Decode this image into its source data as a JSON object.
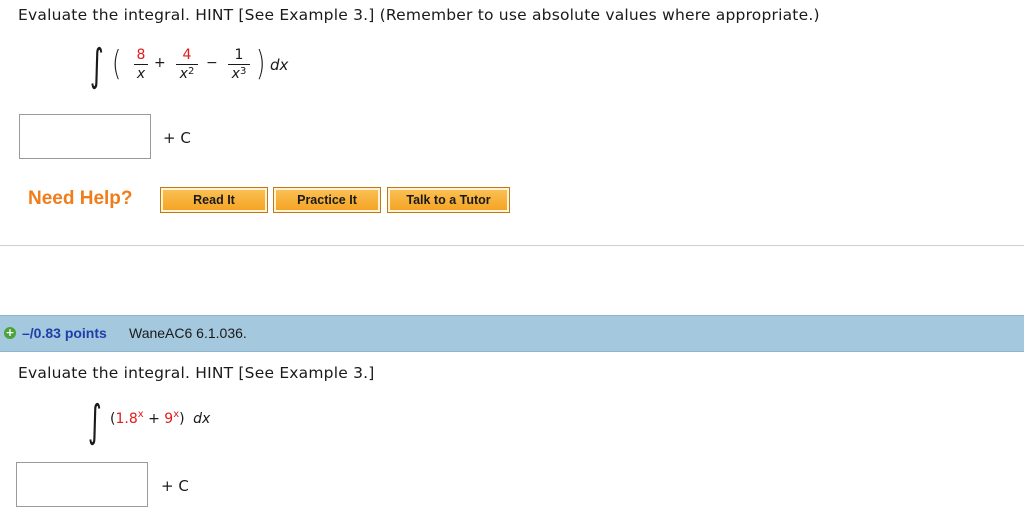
{
  "question1": {
    "prompt": "Evaluate the integral. HINT [See Example 3.] (Remember to use absolute values where appropriate.)",
    "integral_symbol": "∫",
    "open_paren": "(",
    "close_paren": ")",
    "term1_num": "8",
    "term1_den": "x",
    "op1": "+",
    "term2_num": "4",
    "term2_den_base": "x",
    "term2_den_exp": "2",
    "op2": "−",
    "term3_num": "1",
    "term3_den_base": "x",
    "term3_den_exp": "3",
    "dx": "dx",
    "answer_value": "",
    "plus_c": "+ C"
  },
  "help": {
    "label": "Need Help?",
    "buttons": [
      "Read It",
      "Practice It",
      "Talk to a Tutor"
    ]
  },
  "question2": {
    "points": "–/0.83 points",
    "id": "WaneAC6 6.1.036.",
    "prompt": "Evaluate the integral. HINT [See Example 3.]",
    "integral_symbol": "∫",
    "open": "(",
    "base1": "1.8",
    "exp1": "x",
    "op": "+",
    "base2": "9",
    "exp2": "x",
    "close": ")",
    "dx": "dx",
    "answer_value": "",
    "plus_c": "+ C"
  },
  "colors": {
    "accent_red": "#e01b1b",
    "help_orange": "#f07d1a",
    "header_blue": "#a4c8de",
    "points_blue": "#1f3fa8"
  }
}
